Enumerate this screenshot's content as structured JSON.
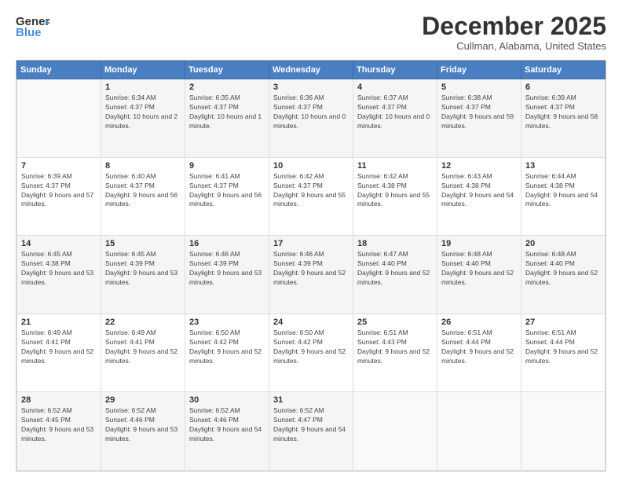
{
  "header": {
    "logo_general": "General",
    "logo_blue": "Blue",
    "title": "December 2025",
    "location": "Cullman, Alabama, United States"
  },
  "calendar": {
    "days_of_week": [
      "Sunday",
      "Monday",
      "Tuesday",
      "Wednesday",
      "Thursday",
      "Friday",
      "Saturday"
    ],
    "weeks": [
      [
        {
          "day": "",
          "sunrise": "",
          "sunset": "",
          "daylight": ""
        },
        {
          "day": "1",
          "sunrise": "Sunrise: 6:34 AM",
          "sunset": "Sunset: 4:37 PM",
          "daylight": "Daylight: 10 hours and 2 minutes."
        },
        {
          "day": "2",
          "sunrise": "Sunrise: 6:35 AM",
          "sunset": "Sunset: 4:37 PM",
          "daylight": "Daylight: 10 hours and 1 minute."
        },
        {
          "day": "3",
          "sunrise": "Sunrise: 6:36 AM",
          "sunset": "Sunset: 4:37 PM",
          "daylight": "Daylight: 10 hours and 0 minutes."
        },
        {
          "day": "4",
          "sunrise": "Sunrise: 6:37 AM",
          "sunset": "Sunset: 4:37 PM",
          "daylight": "Daylight: 10 hours and 0 minutes."
        },
        {
          "day": "5",
          "sunrise": "Sunrise: 6:38 AM",
          "sunset": "Sunset: 4:37 PM",
          "daylight": "Daylight: 9 hours and 59 minutes."
        },
        {
          "day": "6",
          "sunrise": "Sunrise: 6:39 AM",
          "sunset": "Sunset: 4:37 PM",
          "daylight": "Daylight: 9 hours and 58 minutes."
        }
      ],
      [
        {
          "day": "7",
          "sunrise": "Sunrise: 6:39 AM",
          "sunset": "Sunset: 4:37 PM",
          "daylight": "Daylight: 9 hours and 57 minutes."
        },
        {
          "day": "8",
          "sunrise": "Sunrise: 6:40 AM",
          "sunset": "Sunset: 4:37 PM",
          "daylight": "Daylight: 9 hours and 56 minutes."
        },
        {
          "day": "9",
          "sunrise": "Sunrise: 6:41 AM",
          "sunset": "Sunset: 4:37 PM",
          "daylight": "Daylight: 9 hours and 56 minutes."
        },
        {
          "day": "10",
          "sunrise": "Sunrise: 6:42 AM",
          "sunset": "Sunset: 4:37 PM",
          "daylight": "Daylight: 9 hours and 55 minutes."
        },
        {
          "day": "11",
          "sunrise": "Sunrise: 6:42 AM",
          "sunset": "Sunset: 4:38 PM",
          "daylight": "Daylight: 9 hours and 55 minutes."
        },
        {
          "day": "12",
          "sunrise": "Sunrise: 6:43 AM",
          "sunset": "Sunset: 4:38 PM",
          "daylight": "Daylight: 9 hours and 54 minutes."
        },
        {
          "day": "13",
          "sunrise": "Sunrise: 6:44 AM",
          "sunset": "Sunset: 4:38 PM",
          "daylight": "Daylight: 9 hours and 54 minutes."
        }
      ],
      [
        {
          "day": "14",
          "sunrise": "Sunrise: 6:45 AM",
          "sunset": "Sunset: 4:38 PM",
          "daylight": "Daylight: 9 hours and 53 minutes."
        },
        {
          "day": "15",
          "sunrise": "Sunrise: 6:45 AM",
          "sunset": "Sunset: 4:39 PM",
          "daylight": "Daylight: 9 hours and 53 minutes."
        },
        {
          "day": "16",
          "sunrise": "Sunrise: 6:46 AM",
          "sunset": "Sunset: 4:39 PM",
          "daylight": "Daylight: 9 hours and 53 minutes."
        },
        {
          "day": "17",
          "sunrise": "Sunrise: 6:46 AM",
          "sunset": "Sunset: 4:39 PM",
          "daylight": "Daylight: 9 hours and 52 minutes."
        },
        {
          "day": "18",
          "sunrise": "Sunrise: 6:47 AM",
          "sunset": "Sunset: 4:40 PM",
          "daylight": "Daylight: 9 hours and 52 minutes."
        },
        {
          "day": "19",
          "sunrise": "Sunrise: 6:48 AM",
          "sunset": "Sunset: 4:40 PM",
          "daylight": "Daylight: 9 hours and 52 minutes."
        },
        {
          "day": "20",
          "sunrise": "Sunrise: 6:48 AM",
          "sunset": "Sunset: 4:40 PM",
          "daylight": "Daylight: 9 hours and 52 minutes."
        }
      ],
      [
        {
          "day": "21",
          "sunrise": "Sunrise: 6:49 AM",
          "sunset": "Sunset: 4:41 PM",
          "daylight": "Daylight: 9 hours and 52 minutes."
        },
        {
          "day": "22",
          "sunrise": "Sunrise: 6:49 AM",
          "sunset": "Sunset: 4:41 PM",
          "daylight": "Daylight: 9 hours and 52 minutes."
        },
        {
          "day": "23",
          "sunrise": "Sunrise: 6:50 AM",
          "sunset": "Sunset: 4:42 PM",
          "daylight": "Daylight: 9 hours and 52 minutes."
        },
        {
          "day": "24",
          "sunrise": "Sunrise: 6:50 AM",
          "sunset": "Sunset: 4:42 PM",
          "daylight": "Daylight: 9 hours and 52 minutes."
        },
        {
          "day": "25",
          "sunrise": "Sunrise: 6:51 AM",
          "sunset": "Sunset: 4:43 PM",
          "daylight": "Daylight: 9 hours and 52 minutes."
        },
        {
          "day": "26",
          "sunrise": "Sunrise: 6:51 AM",
          "sunset": "Sunset: 4:44 PM",
          "daylight": "Daylight: 9 hours and 52 minutes."
        },
        {
          "day": "27",
          "sunrise": "Sunrise: 6:51 AM",
          "sunset": "Sunset: 4:44 PM",
          "daylight": "Daylight: 9 hours and 52 minutes."
        }
      ],
      [
        {
          "day": "28",
          "sunrise": "Sunrise: 6:52 AM",
          "sunset": "Sunset: 4:45 PM",
          "daylight": "Daylight: 9 hours and 53 minutes."
        },
        {
          "day": "29",
          "sunrise": "Sunrise: 6:52 AM",
          "sunset": "Sunset: 4:46 PM",
          "daylight": "Daylight: 9 hours and 53 minutes."
        },
        {
          "day": "30",
          "sunrise": "Sunrise: 6:52 AM",
          "sunset": "Sunset: 4:46 PM",
          "daylight": "Daylight: 9 hours and 54 minutes."
        },
        {
          "day": "31",
          "sunrise": "Sunrise: 6:52 AM",
          "sunset": "Sunset: 4:47 PM",
          "daylight": "Daylight: 9 hours and 54 minutes."
        },
        {
          "day": "",
          "sunrise": "",
          "sunset": "",
          "daylight": ""
        },
        {
          "day": "",
          "sunrise": "",
          "sunset": "",
          "daylight": ""
        },
        {
          "day": "",
          "sunrise": "",
          "sunset": "",
          "daylight": ""
        }
      ]
    ]
  }
}
